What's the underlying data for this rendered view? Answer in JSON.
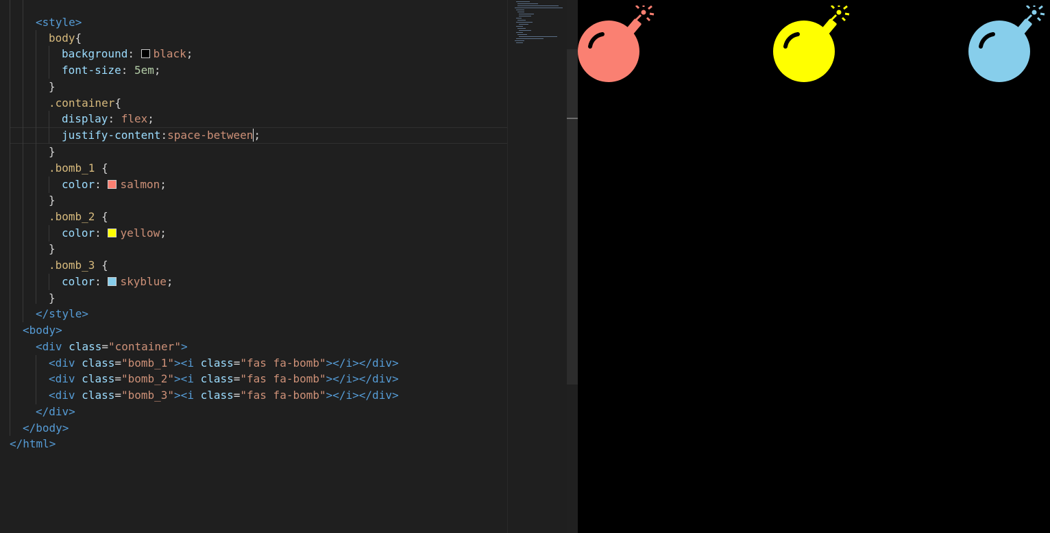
{
  "editor": {
    "lines": [
      {
        "segments": [
          {
            "t": "<style>",
            "c": "tag"
          }
        ]
      },
      {
        "segments": [
          {
            "t": "body",
            "c": "sel"
          },
          {
            "t": "{",
            "c": "txt"
          }
        ]
      },
      {
        "segments": [
          {
            "t": "background",
            "c": "prop"
          },
          {
            "t": ": ",
            "c": "txt"
          },
          {
            "swatch": "#000000"
          },
          {
            "t": "black",
            "c": "val"
          },
          {
            "t": ";",
            "c": "txt"
          }
        ]
      },
      {
        "segments": [
          {
            "t": "font-size",
            "c": "prop"
          },
          {
            "t": ": ",
            "c": "txt"
          },
          {
            "t": "5em",
            "c": "num"
          },
          {
            "t": ";",
            "c": "txt"
          }
        ]
      },
      {
        "segments": [
          {
            "t": "}",
            "c": "txt"
          }
        ]
      },
      {
        "segments": [
          {
            "t": ".container",
            "c": "sel"
          },
          {
            "t": "{",
            "c": "txt"
          }
        ]
      },
      {
        "segments": [
          {
            "t": "display",
            "c": "prop"
          },
          {
            "t": ": ",
            "c": "txt"
          },
          {
            "t": "flex",
            "c": "val"
          },
          {
            "t": ";",
            "c": "txt"
          }
        ]
      },
      {
        "segments": [
          {
            "t": "justify-content",
            "c": "prop"
          },
          {
            "t": ":",
            "c": "txt"
          },
          {
            "t": "space-between",
            "c": "val"
          },
          {
            "caret": true
          },
          {
            "t": ";",
            "c": "txt"
          }
        ]
      },
      {
        "segments": [
          {
            "t": "}",
            "c": "txt"
          }
        ]
      },
      {
        "segments": [
          {
            "t": ".bomb_1",
            "c": "sel"
          },
          {
            "t": " {",
            "c": "txt"
          }
        ]
      },
      {
        "segments": [
          {
            "t": "color",
            "c": "prop"
          },
          {
            "t": ": ",
            "c": "txt"
          },
          {
            "swatch": "#fa8072"
          },
          {
            "t": "salmon",
            "c": "val"
          },
          {
            "t": ";",
            "c": "txt"
          }
        ]
      },
      {
        "segments": [
          {
            "t": "}",
            "c": "txt"
          }
        ]
      },
      {
        "segments": [
          {
            "t": ".bomb_2",
            "c": "sel"
          },
          {
            "t": " {",
            "c": "txt"
          }
        ]
      },
      {
        "segments": [
          {
            "t": "color",
            "c": "prop"
          },
          {
            "t": ": ",
            "c": "txt"
          },
          {
            "swatch": "#ffff00"
          },
          {
            "t": "yellow",
            "c": "val"
          },
          {
            "t": ";",
            "c": "txt"
          }
        ]
      },
      {
        "segments": [
          {
            "t": "}",
            "c": "txt"
          }
        ]
      },
      {
        "segments": [
          {
            "t": ".bomb_3",
            "c": "sel"
          },
          {
            "t": " {",
            "c": "txt"
          }
        ]
      },
      {
        "segments": [
          {
            "t": "color",
            "c": "prop"
          },
          {
            "t": ": ",
            "c": "txt"
          },
          {
            "swatch": "#87ceeb"
          },
          {
            "t": "skyblue",
            "c": "val"
          },
          {
            "t": ";",
            "c": "txt"
          }
        ]
      },
      {
        "segments": [
          {
            "t": "}",
            "c": "txt"
          }
        ]
      },
      {
        "segments": [
          {
            "t": "</style>",
            "c": "tag"
          }
        ]
      },
      {
        "segments": [
          {
            "t": "<body>",
            "c": "tag"
          }
        ]
      },
      {
        "segments": [
          {
            "t": "<div ",
            "c": "tag"
          },
          {
            "t": "class",
            "c": "attr"
          },
          {
            "t": "=",
            "c": "txt"
          },
          {
            "t": "\"container\"",
            "c": "str"
          },
          {
            "t": ">",
            "c": "tag"
          }
        ]
      },
      {
        "segments": [
          {
            "t": "<div ",
            "c": "tag"
          },
          {
            "t": "class",
            "c": "attr"
          },
          {
            "t": "=",
            "c": "txt"
          },
          {
            "t": "\"bomb_1\"",
            "c": "str"
          },
          {
            "t": "><i ",
            "c": "tag"
          },
          {
            "t": "class",
            "c": "attr"
          },
          {
            "t": "=",
            "c": "txt"
          },
          {
            "t": "\"fas fa-bomb\"",
            "c": "str"
          },
          {
            "t": "></i></div>",
            "c": "tag"
          }
        ]
      },
      {
        "segments": [
          {
            "t": "<div ",
            "c": "tag"
          },
          {
            "t": "class",
            "c": "attr"
          },
          {
            "t": "=",
            "c": "txt"
          },
          {
            "t": "\"bomb_2\"",
            "c": "str"
          },
          {
            "t": "><i ",
            "c": "tag"
          },
          {
            "t": "class",
            "c": "attr"
          },
          {
            "t": "=",
            "c": "txt"
          },
          {
            "t": "\"fas fa-bomb\"",
            "c": "str"
          },
          {
            "t": "></i></div>",
            "c": "tag"
          }
        ]
      },
      {
        "segments": [
          {
            "t": "<div ",
            "c": "tag"
          },
          {
            "t": "class",
            "c": "attr"
          },
          {
            "t": "=",
            "c": "txt"
          },
          {
            "t": "\"bomb_3\"",
            "c": "str"
          },
          {
            "t": "><i ",
            "c": "tag"
          },
          {
            "t": "class",
            "c": "attr"
          },
          {
            "t": "=",
            "c": "txt"
          },
          {
            "t": "\"fas fa-bomb\"",
            "c": "str"
          },
          {
            "t": "></i></div>",
            "c": "tag"
          }
        ]
      },
      {
        "segments": [
          {
            "t": "</div>",
            "c": "tag"
          }
        ]
      },
      {
        "segments": [
          {
            "t": "</body>",
            "c": "tag"
          }
        ]
      },
      {
        "segments": [
          {
            "t": "</html>",
            "c": "tag"
          }
        ]
      }
    ]
  },
  "preview": {
    "bombs": [
      {
        "name": "salmon-bomb-icon",
        "color": "#fa8072"
      },
      {
        "name": "yellow-bomb-icon",
        "color": "#ffff00"
      },
      {
        "name": "skyblue-bomb-icon",
        "color": "#87ceeb"
      }
    ]
  }
}
